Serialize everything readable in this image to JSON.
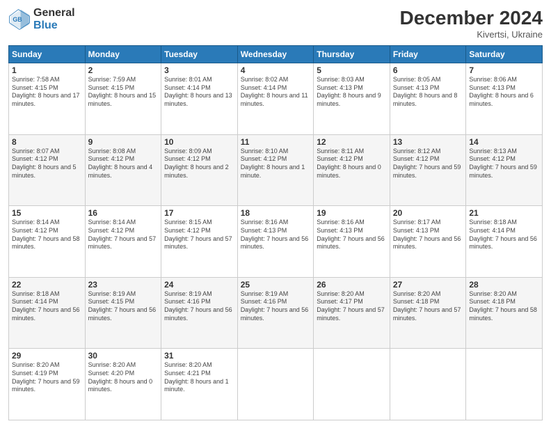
{
  "logo": {
    "general": "General",
    "blue": "Blue"
  },
  "title": "December 2024",
  "subtitle": "Kivertsi, Ukraine",
  "days_header": [
    "Sunday",
    "Monday",
    "Tuesday",
    "Wednesday",
    "Thursday",
    "Friday",
    "Saturday"
  ],
  "weeks": [
    [
      {
        "day": "1",
        "sunrise": "7:58 AM",
        "sunset": "4:15 PM",
        "daylight": "8 hours and 17 minutes."
      },
      {
        "day": "2",
        "sunrise": "7:59 AM",
        "sunset": "4:15 PM",
        "daylight": "8 hours and 15 minutes."
      },
      {
        "day": "3",
        "sunrise": "8:01 AM",
        "sunset": "4:14 PM",
        "daylight": "8 hours and 13 minutes."
      },
      {
        "day": "4",
        "sunrise": "8:02 AM",
        "sunset": "4:14 PM",
        "daylight": "8 hours and 11 minutes."
      },
      {
        "day": "5",
        "sunrise": "8:03 AM",
        "sunset": "4:13 PM",
        "daylight": "8 hours and 9 minutes."
      },
      {
        "day": "6",
        "sunrise": "8:05 AM",
        "sunset": "4:13 PM",
        "daylight": "8 hours and 8 minutes."
      },
      {
        "day": "7",
        "sunrise": "8:06 AM",
        "sunset": "4:13 PM",
        "daylight": "8 hours and 6 minutes."
      }
    ],
    [
      {
        "day": "8",
        "sunrise": "8:07 AM",
        "sunset": "4:12 PM",
        "daylight": "8 hours and 5 minutes."
      },
      {
        "day": "9",
        "sunrise": "8:08 AM",
        "sunset": "4:12 PM",
        "daylight": "8 hours and 4 minutes."
      },
      {
        "day": "10",
        "sunrise": "8:09 AM",
        "sunset": "4:12 PM",
        "daylight": "8 hours and 2 minutes."
      },
      {
        "day": "11",
        "sunrise": "8:10 AM",
        "sunset": "4:12 PM",
        "daylight": "8 hours and 1 minute."
      },
      {
        "day": "12",
        "sunrise": "8:11 AM",
        "sunset": "4:12 PM",
        "daylight": "8 hours and 0 minutes."
      },
      {
        "day": "13",
        "sunrise": "8:12 AM",
        "sunset": "4:12 PM",
        "daylight": "7 hours and 59 minutes."
      },
      {
        "day": "14",
        "sunrise": "8:13 AM",
        "sunset": "4:12 PM",
        "daylight": "7 hours and 59 minutes."
      }
    ],
    [
      {
        "day": "15",
        "sunrise": "8:14 AM",
        "sunset": "4:12 PM",
        "daylight": "7 hours and 58 minutes."
      },
      {
        "day": "16",
        "sunrise": "8:14 AM",
        "sunset": "4:12 PM",
        "daylight": "7 hours and 57 minutes."
      },
      {
        "day": "17",
        "sunrise": "8:15 AM",
        "sunset": "4:12 PM",
        "daylight": "7 hours and 57 minutes."
      },
      {
        "day": "18",
        "sunrise": "8:16 AM",
        "sunset": "4:13 PM",
        "daylight": "7 hours and 56 minutes."
      },
      {
        "day": "19",
        "sunrise": "8:16 AM",
        "sunset": "4:13 PM",
        "daylight": "7 hours and 56 minutes."
      },
      {
        "day": "20",
        "sunrise": "8:17 AM",
        "sunset": "4:13 PM",
        "daylight": "7 hours and 56 minutes."
      },
      {
        "day": "21",
        "sunrise": "8:18 AM",
        "sunset": "4:14 PM",
        "daylight": "7 hours and 56 minutes."
      }
    ],
    [
      {
        "day": "22",
        "sunrise": "8:18 AM",
        "sunset": "4:14 PM",
        "daylight": "7 hours and 56 minutes."
      },
      {
        "day": "23",
        "sunrise": "8:19 AM",
        "sunset": "4:15 PM",
        "daylight": "7 hours and 56 minutes."
      },
      {
        "day": "24",
        "sunrise": "8:19 AM",
        "sunset": "4:16 PM",
        "daylight": "7 hours and 56 minutes."
      },
      {
        "day": "25",
        "sunrise": "8:19 AM",
        "sunset": "4:16 PM",
        "daylight": "7 hours and 56 minutes."
      },
      {
        "day": "26",
        "sunrise": "8:20 AM",
        "sunset": "4:17 PM",
        "daylight": "7 hours and 57 minutes."
      },
      {
        "day": "27",
        "sunrise": "8:20 AM",
        "sunset": "4:18 PM",
        "daylight": "7 hours and 57 minutes."
      },
      {
        "day": "28",
        "sunrise": "8:20 AM",
        "sunset": "4:18 PM",
        "daylight": "7 hours and 58 minutes."
      }
    ],
    [
      {
        "day": "29",
        "sunrise": "8:20 AM",
        "sunset": "4:19 PM",
        "daylight": "7 hours and 59 minutes."
      },
      {
        "day": "30",
        "sunrise": "8:20 AM",
        "sunset": "4:20 PM",
        "daylight": "8 hours and 0 minutes."
      },
      {
        "day": "31",
        "sunrise": "8:20 AM",
        "sunset": "4:21 PM",
        "daylight": "8 hours and 1 minute."
      },
      null,
      null,
      null,
      null
    ]
  ]
}
